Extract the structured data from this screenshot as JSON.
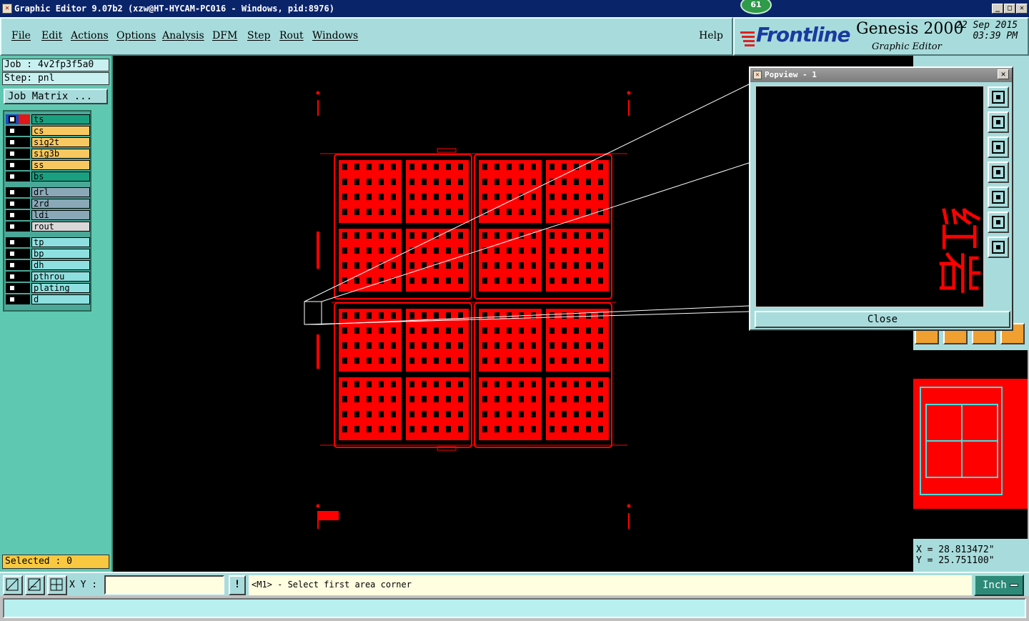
{
  "window": {
    "title": "Graphic Editor 9.07b2 (xzw@HT-HYCAM-PC016 - Windows, pid:8976)",
    "notification_badge": "61"
  },
  "menu": {
    "items": [
      "File",
      "Edit",
      "Actions",
      "Options",
      "Analysis",
      "DFM",
      "Step",
      "Rout",
      "Windows"
    ],
    "help": "Help"
  },
  "logo": {
    "brand": "Frontline",
    "product": "Genesis 2000",
    "subtitle": "Graphic Editor",
    "date": "22 Sep 2015",
    "time": "03:39 PM"
  },
  "job": {
    "job_label": "Job : 4v2fp3f5a0",
    "step_label": "Step: pnl",
    "matrix_button": "Job Matrix ..."
  },
  "layers": [
    {
      "name": "ts",
      "color": "#1aa080",
      "active": true
    },
    {
      "name": "cs",
      "color": "#f8c860"
    },
    {
      "name": "sig2t",
      "color": "#f8c860"
    },
    {
      "name": "sig3b",
      "color": "#f8c860"
    },
    {
      "name": "ss",
      "color": "#f8c860"
    },
    {
      "name": "bs",
      "color": "#1aa080"
    },
    {
      "name": "drl",
      "color": "#8aa8b8"
    },
    {
      "name": "2rd",
      "color": "#8aa8b8"
    },
    {
      "name": "ldi",
      "color": "#8aa8b8"
    },
    {
      "name": "rout",
      "color": "#d8d8d8"
    },
    {
      "name": "tp",
      "color": "#8ee0e0"
    },
    {
      "name": "bp",
      "color": "#8ee0e0"
    },
    {
      "name": "dh",
      "color": "#8ee0e0"
    },
    {
      "name": "pthrou",
      "color": "#8ee0e0"
    },
    {
      "name": "plating",
      "color": "#8ee0e0"
    },
    {
      "name": "d",
      "color": "#8ee0e0"
    }
  ],
  "selected_label": "Selected : 0",
  "popup": {
    "title": "Popview - 1",
    "close_button": "Close",
    "zoom_glyphs": "红岩"
  },
  "coordinates": {
    "x": "X = 28.813472\"",
    "y": "Y = 25.751100\""
  },
  "bottom": {
    "xy_label": "X Y :",
    "xy_value": "",
    "warn_glyph": "!",
    "prompt": "<M1> - Select first area corner",
    "unit": "Inch"
  },
  "colors": {
    "feature_red": "#ff0000",
    "panel_teal": "#a8dcdc",
    "left_panel": "#5fc8b0"
  }
}
